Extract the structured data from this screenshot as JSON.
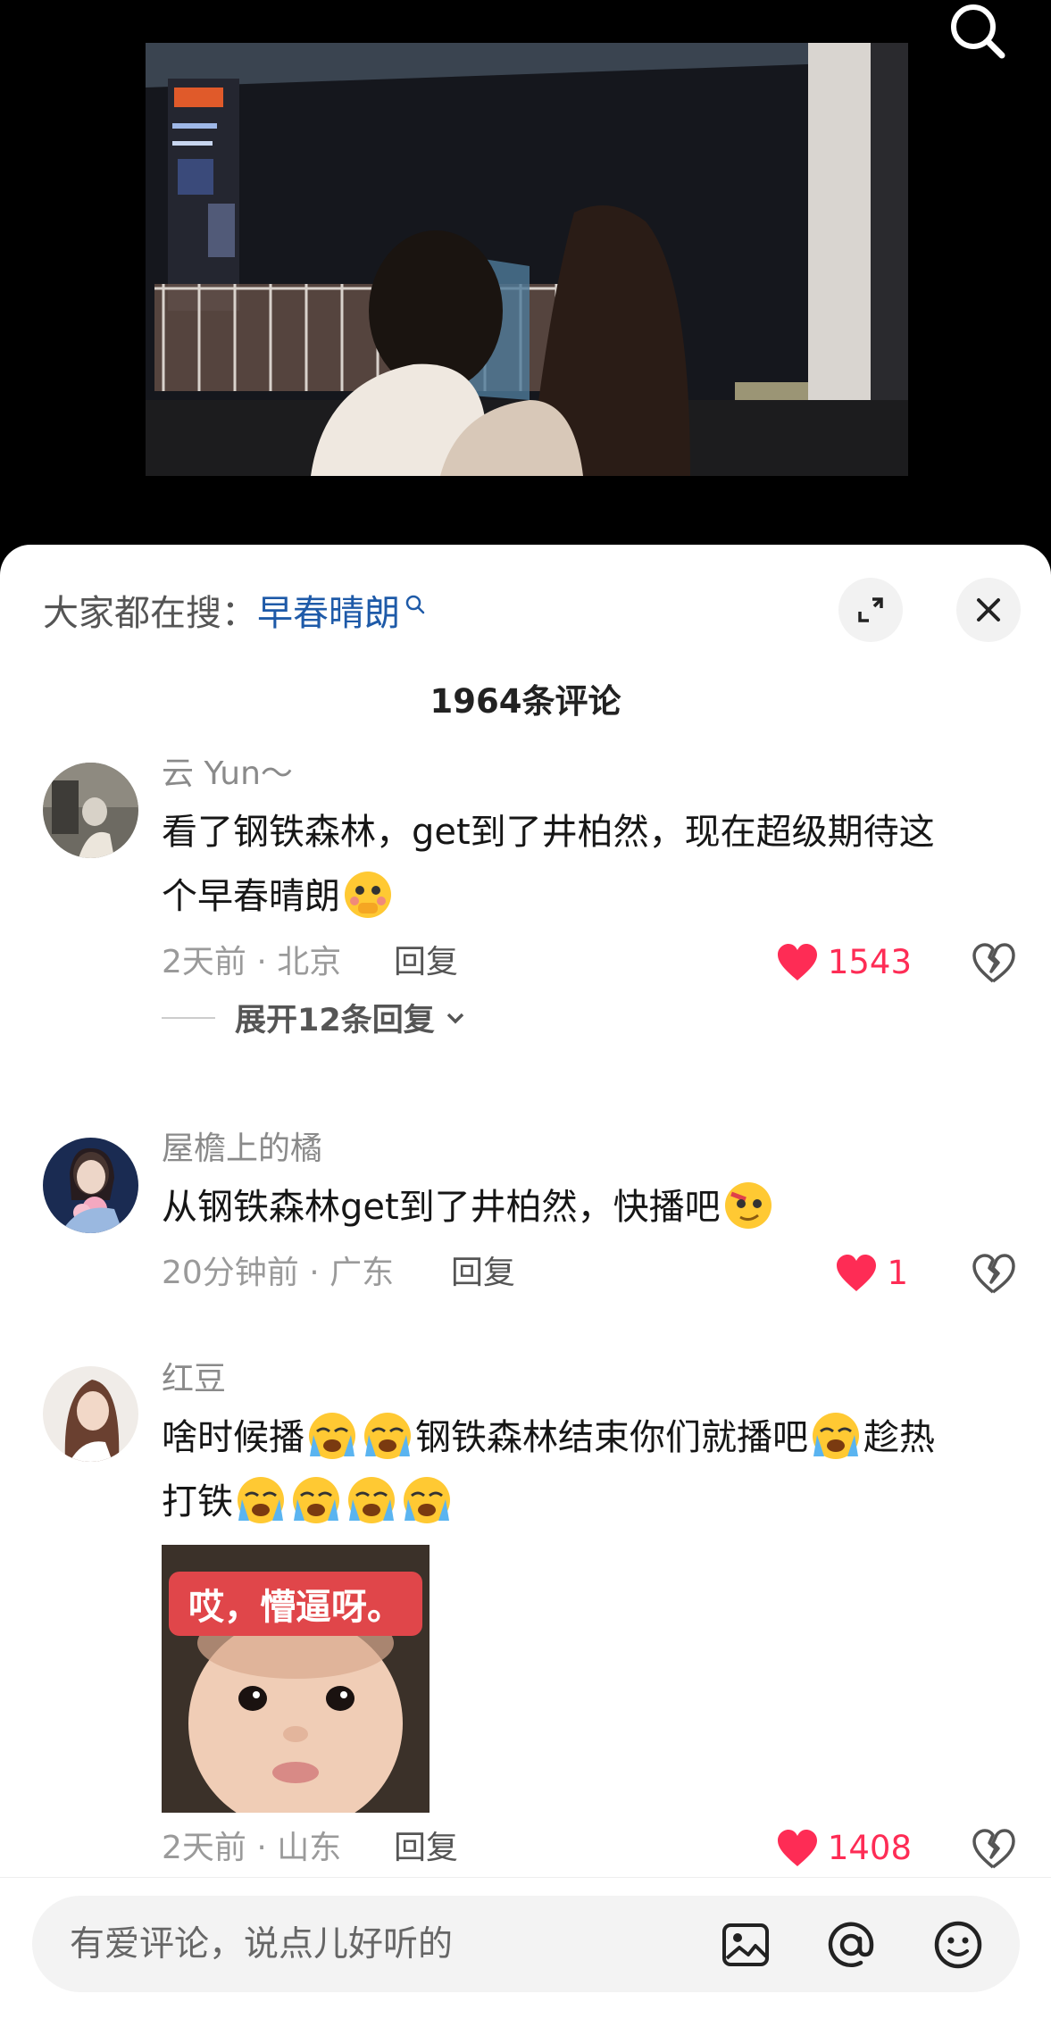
{
  "header": {
    "search_icon": "search-icon"
  },
  "sheet": {
    "trend_prefix": "大家都在搜：",
    "trend_keyword": "早春晴朗",
    "expand_icon": "expand-icon",
    "close_icon": "close-icon",
    "comment_count": "1964条评论"
  },
  "comments": [
    {
      "name": "云 Yun～",
      "text_line1": "看了钢铁森林，get到了井柏然，现在超级期待这",
      "text_line2": "个早春晴朗",
      "time_location": "2天前 · 北京",
      "reply": "回复",
      "likes": "1543",
      "expand_replies": "展开12条回复"
    },
    {
      "name": "屋檐上的橘",
      "text": "从钢铁森林get到了井柏然，快播吧",
      "time_location": "20分钟前 · 广东",
      "reply": "回复",
      "likes": "1"
    },
    {
      "name": "红豆",
      "text_part1": "啥时候播",
      "text_part2": "钢铁森林结束你们就播吧",
      "text_part3": "趁热",
      "text_part4": "打铁",
      "sticker_text": "哎，懵逼呀。",
      "time_location": "2天前 · 山东",
      "reply": "回复",
      "likes": "1408"
    }
  ],
  "input": {
    "placeholder": "有爱评论，说点儿好听的",
    "image_icon": "image-icon",
    "mention_icon": "at-icon",
    "emoji_icon": "emoji-icon"
  },
  "colors": {
    "accent": "#fe2c55",
    "keyword": "#1e5aa8"
  }
}
